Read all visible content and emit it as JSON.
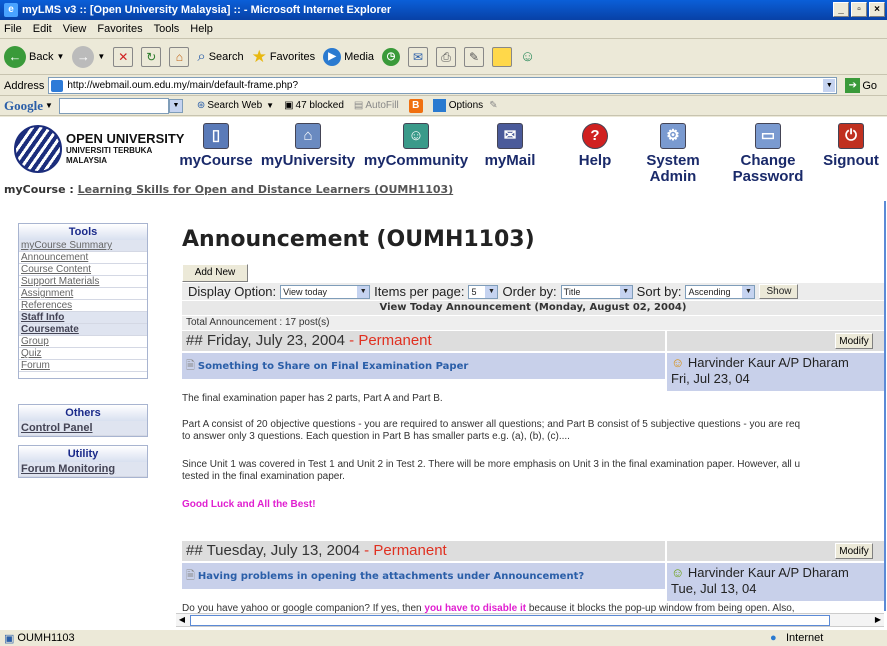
{
  "window": {
    "title": "myLMS v3 :: [Open University Malaysia] :: - Microsoft Internet Explorer"
  },
  "menu": [
    "File",
    "Edit",
    "View",
    "Favorites",
    "Tools",
    "Help"
  ],
  "toolbar": {
    "back": "Back",
    "search": "Search",
    "favorites": "Favorites",
    "media": "Media"
  },
  "address": {
    "label": "Address",
    "url": "http://webmail.oum.edu.my/main/default-frame.php?",
    "go": "Go"
  },
  "google": {
    "label": "Google",
    "search_web": "Search Web",
    "blocked": "47 blocked",
    "autofill": "AutoFill",
    "options": "Options"
  },
  "logo": {
    "line1": "OPEN UNIVERSITY",
    "line2": "UNIVERSITI TERBUKA",
    "line3": "MALAYSIA"
  },
  "nav": [
    {
      "label": "myCourse",
      "icon": "document-icon",
      "color": "#5a7ab8"
    },
    {
      "label": "myUniversity",
      "icon": "house-icon",
      "color": "#6a8ac0"
    },
    {
      "label": "myCommunity",
      "icon": "people-icon",
      "color": "#3a9a8a"
    },
    {
      "label": "myMail",
      "icon": "mail-icon",
      "color": "#4a5a9a"
    },
    {
      "label": "Help",
      "icon": "help-icon",
      "color": "#d02020"
    },
    {
      "label": "System Admin",
      "icon": "admin-icon",
      "color": "#7a9ad0"
    },
    {
      "label": "Change Password",
      "icon": "password-icon",
      "color": "#7a9ad0"
    },
    {
      "label": "Signout",
      "icon": "signout-icon",
      "color": "#c03020"
    }
  ],
  "breadcrumb": {
    "prefix": "myCourse :",
    "link": "Learning Skills for Open and Distance Learners (OUMH1103)"
  },
  "sidebar": {
    "tools_title": "Tools",
    "tools": [
      "myCourse Summary",
      "Announcement",
      "Course Content",
      "Support Materials",
      "Assignment",
      "References",
      "Staff Info",
      "Coursemate",
      "Group",
      "Quiz",
      "Forum"
    ],
    "others_title": "Others",
    "others": [
      "Control Panel"
    ],
    "utility_title": "Utility",
    "utility": [
      "Forum Monitoring"
    ]
  },
  "page_title": "Announcement (OUMH1103)",
  "add_new": "Add New",
  "options": {
    "display_label": "Display Option:",
    "display_value": "View today",
    "items_label": "Items per page:",
    "items_value": "5",
    "order_label": "Order by:",
    "order_value": "Title",
    "sort_label": "Sort by:",
    "sort_value": "Ascending",
    "show": "Show"
  },
  "view_today": "View Today Announcement (Monday, August 02, 2004)",
  "total": "Total Announcement : 17 post(s)",
  "announcements": [
    {
      "date": "## Friday, July 23, 2004",
      "tag": " - Permanent",
      "title": "Something to Share on Final Examination Paper",
      "author": "Harvinder Kaur A/P Dharam",
      "posted": "Fri, Jul 23, 04",
      "modify": "Modify",
      "p1": "The final examination paper has 2 parts, Part A and Part B.",
      "p2a": "Part A consist of 20 objective questions - you are required to answer all questions; and Part B consist of 5 subjective questions - you are req",
      "p2b": "to answer only 3 questions. Each question in Part B has smaller parts e.g. (a), (b), (c)....",
      "p3a": "Since Unit 1 was covered in Test 1 and  Unit 2 in Test 2. There will be more emphasis on Unit 3 in the final examination paper. However, all u",
      "p3b": "tested in the final examination paper.",
      "closing": "Good Luck and All the Best!"
    },
    {
      "date": "## Tuesday, July 13, 2004",
      "tag": " - Permanent",
      "title": "Having problems in opening the attachments under Announcement?",
      "author": "Harvinder Kaur A/P Dharam",
      "posted": "Tue, Jul 13, 04",
      "modify": "Modify",
      "p1a": "Do you have yahoo or google companion? If yes, then ",
      "p1b": "you have to disable it",
      "p1c": " because it blocks the pop-up window from being open. Also,"
    }
  ],
  "status": {
    "left": "OUMH1103",
    "zone": "Internet"
  }
}
